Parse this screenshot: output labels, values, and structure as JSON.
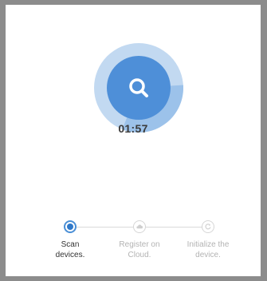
{
  "scan": {
    "timer": "01:57",
    "progress": 0.32,
    "colors": {
      "outer_ring": "#c2d9f1",
      "progress_arc": "#9cc2ea",
      "inner_circle": "#4e8fd8",
      "icon": "#ffffff"
    }
  },
  "steps": [
    {
      "label": "Scan\ndevices.",
      "state": "active",
      "icon": "radio-dot-icon"
    },
    {
      "label": "Register on\nCloud.",
      "state": "pending",
      "icon": "cloud-icon"
    },
    {
      "label": "Initialize the\ndevice.",
      "state": "pending",
      "icon": "refresh-icon"
    }
  ]
}
